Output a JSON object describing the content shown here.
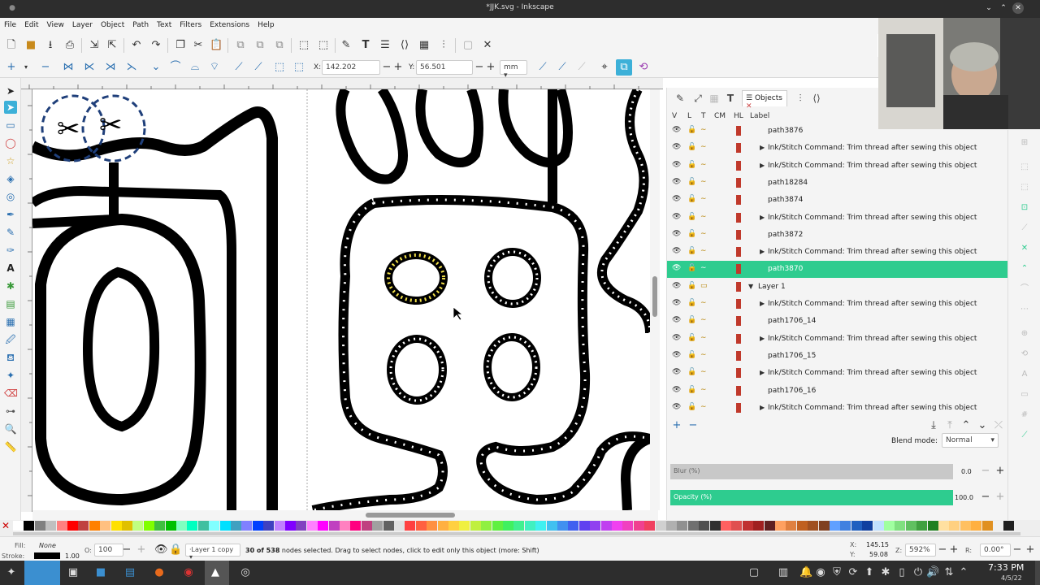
{
  "window": {
    "title": "*JJK.svg - Inkscape"
  },
  "menu": [
    "File",
    "Edit",
    "View",
    "Layer",
    "Object",
    "Path",
    "Text",
    "Filters",
    "Extensions",
    "Help"
  ],
  "node_toolbar": {
    "x_label": "X:",
    "x_value": "142.202",
    "y_label": "Y:",
    "y_value": "56.501",
    "unit": "mm"
  },
  "objects_panel": {
    "tab_label": "Objects",
    "headers": [
      "V",
      "L",
      "T",
      "CM",
      "HL",
      "Label"
    ],
    "rows": [
      {
        "label": "path3876",
        "expandable": false,
        "selected": false
      },
      {
        "label": "Ink/Stitch Command: Trim thread after sewing this object",
        "expandable": true,
        "selected": false
      },
      {
        "label": "Ink/Stitch Command: Trim thread after sewing this object",
        "expandable": true,
        "selected": false
      },
      {
        "label": "path18284",
        "expandable": false,
        "selected": false
      },
      {
        "label": "path3874",
        "expandable": false,
        "selected": false
      },
      {
        "label": "Ink/Stitch Command: Trim thread after sewing this object",
        "expandable": true,
        "selected": false
      },
      {
        "label": "path3872",
        "expandable": false,
        "selected": false
      },
      {
        "label": "Ink/Stitch Command: Trim thread after sewing this object",
        "expandable": true,
        "selected": false
      },
      {
        "label": "path3870",
        "expandable": false,
        "selected": true
      },
      {
        "label": "Layer 1",
        "expandable": true,
        "expanded": true,
        "selected": false
      },
      {
        "label": "Ink/Stitch Command: Trim thread after sewing this object",
        "expandable": true,
        "selected": false
      },
      {
        "label": "path1706_14",
        "expandable": false,
        "selected": false
      },
      {
        "label": "Ink/Stitch Command: Trim thread after sewing this object",
        "expandable": true,
        "selected": false
      },
      {
        "label": "path1706_15",
        "expandable": false,
        "selected": false
      },
      {
        "label": "Ink/Stitch Command: Trim thread after sewing this object",
        "expandable": true,
        "selected": false
      },
      {
        "label": "path1706_16",
        "expandable": false,
        "selected": false
      },
      {
        "label": "Ink/Stitch Command: Trim thread after sewing this object",
        "expandable": true,
        "selected": false
      }
    ],
    "blend_label": "Blend mode:",
    "blend_value": "Normal",
    "blur_label": "Blur (%)",
    "blur_value": "0.0",
    "opacity_label": "Opacity (%)",
    "opacity_value": "100.0"
  },
  "status": {
    "fill_label": "Fill:",
    "fill_value": "None",
    "stroke_label": "Stroke:",
    "stroke_width": "1.00",
    "opacity_label": "O:",
    "opacity_value": "100",
    "layer": "Layer 1 copy",
    "message_bold": "30 of 538",
    "message": " nodes selected. Drag to select nodes, click to edit only this object (more: Shift)",
    "cursor_x_label": "X:",
    "cursor_x": "145.15",
    "cursor_y_label": "Y:",
    "cursor_y": "59.08",
    "zoom_label": "Z:",
    "zoom": "592%",
    "rotate_label": "R:",
    "rotate": "0.00°"
  },
  "taskbar": {
    "time": "7:33 PM",
    "date": "4/5/22"
  },
  "colors": {
    "accent": "#2ecc8f",
    "selected_row": "#2ecc8f",
    "dash": "#1f3f7a"
  }
}
